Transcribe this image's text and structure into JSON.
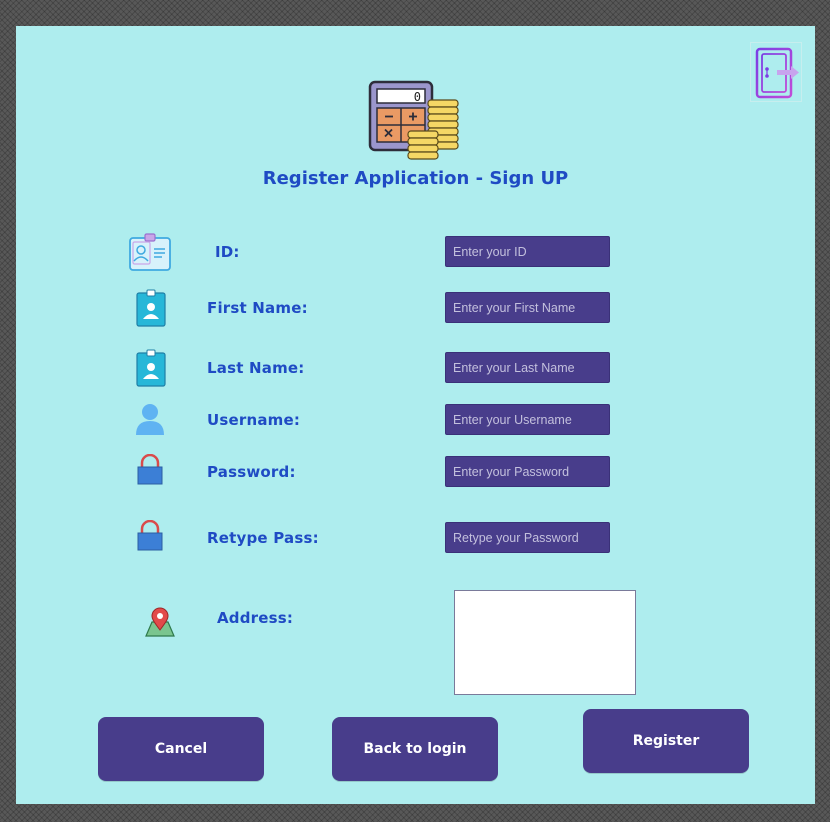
{
  "form": {
    "title": "Register Application - Sign UP",
    "fields": [
      {
        "label": "ID:",
        "placeholder": "Enter your ID"
      },
      {
        "label": "First Name:",
        "placeholder": "Enter your First Name"
      },
      {
        "label": "Last Name:",
        "placeholder": "Enter your Last Name"
      },
      {
        "label": "Username:",
        "placeholder": "Enter your Username"
      },
      {
        "label": "Password:",
        "placeholder": "Enter your Password"
      },
      {
        "label": "Retype Pass:",
        "placeholder": "Retype your Password"
      }
    ],
    "address_label": "Address:",
    "address_value": ""
  },
  "calculator_display": "0",
  "buttons": {
    "cancel": "Cancel",
    "back": "Back to login",
    "register": "Register"
  },
  "icons": {
    "logo": "calculator-coins-icon",
    "exit": "exit-door-icon",
    "id": "id-card-icon",
    "first_name": "id-badge-icon",
    "last_name": "id-badge-icon",
    "username": "user-icon",
    "password": "padlock-icon",
    "retype": "padlock-icon",
    "address": "map-pin-icon"
  },
  "colors": {
    "background": "#aeedee",
    "accent": "#483d8b",
    "label": "#1f4bc4"
  }
}
